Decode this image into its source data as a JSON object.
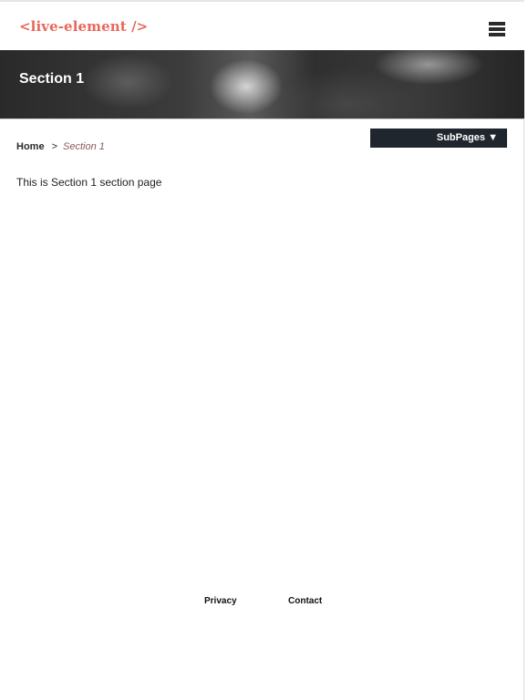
{
  "header": {
    "logo_text": "<live-element />",
    "menu_icon": "hamburger-menu-icon"
  },
  "hero": {
    "title": "Section 1"
  },
  "breadcrumb": {
    "home_label": "Home",
    "separator": ">",
    "current_label": "Section 1"
  },
  "subpages": {
    "label": "SubPages ▼"
  },
  "main": {
    "body_text": "This is Section 1 section page"
  },
  "footer": {
    "links": [
      {
        "label": "Privacy"
      },
      {
        "label": "Contact"
      }
    ]
  },
  "colors": {
    "logo": "#e8675a",
    "subpages_button_bg": "#1f262d",
    "breadcrumb_current": "#8a5a5a"
  }
}
